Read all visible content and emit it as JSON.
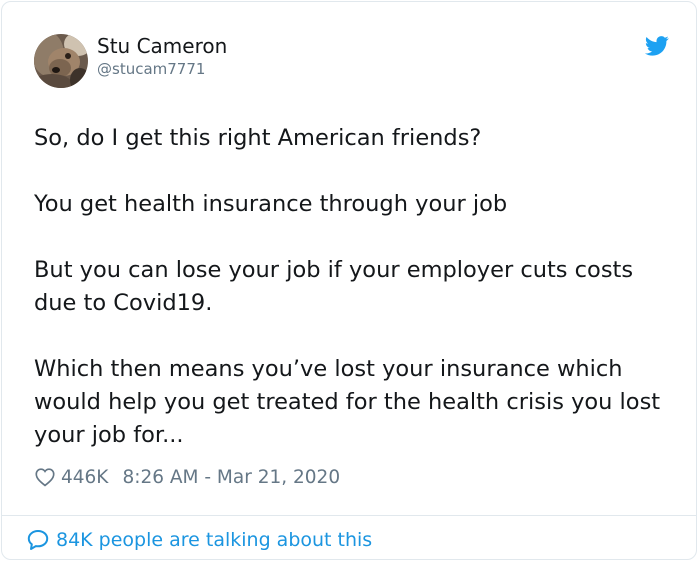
{
  "author": {
    "name": "Stu Cameron",
    "handle": "@stucam7771"
  },
  "tweet": {
    "paragraphs": [
      "So, do I get this right American friends?",
      "You get health insurance through your job",
      "But you can lose your job if your employer cuts costs due to Covid19.",
      "Which then means you’ve lost your insurance which would help you get treated for the health crisis you lost your job for..."
    ]
  },
  "meta": {
    "likes": "446K",
    "timestamp": "8:26 AM - Mar 21, 2020"
  },
  "footer": {
    "talking_label": "84K people are talking about this"
  },
  "icons": {
    "avatar": "dog-photo-avatar",
    "logo": "twitter-bird-icon",
    "like": "heart-icon",
    "reply": "speech-bubble-icon"
  },
  "colors": {
    "text": "#14171a",
    "secondary": "#657786",
    "link": "#1b95e0",
    "twitter_blue": "#1da1f2",
    "border": "#e1e8ed"
  }
}
